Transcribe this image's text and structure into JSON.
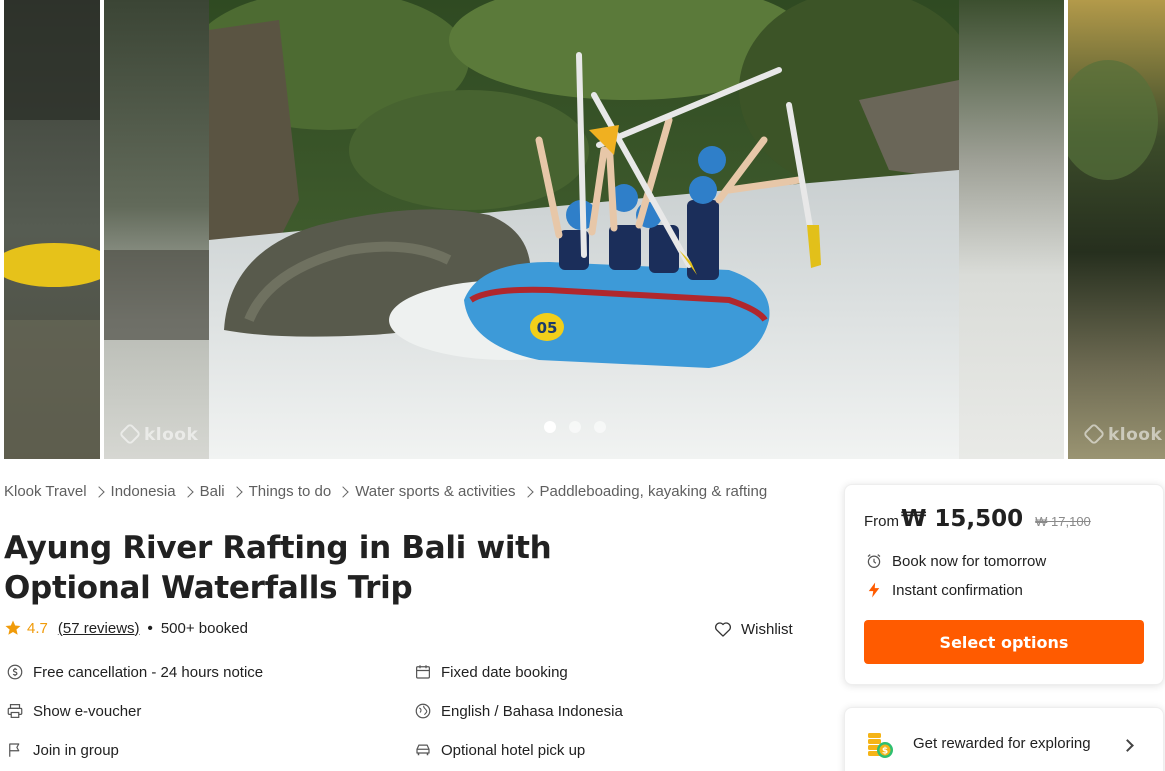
{
  "gallery": {
    "watermark": "klook",
    "slide_count": 3,
    "active_slide": 0,
    "raft_number": "05"
  },
  "breadcrumb": [
    "Klook Travel",
    "Indonesia",
    "Bali",
    "Things to do",
    "Water sports & activities",
    "Paddleboading, kayaking & rafting"
  ],
  "activity": {
    "title": "Ayung River Rafting in Bali with Optional Waterfalls Trip",
    "rating": "4.7",
    "reviews_link": "(57 reviews)",
    "booked": "500+ booked",
    "wishlist_label": "Wishlist"
  },
  "features": {
    "left": [
      {
        "label": "Free cancellation - 24 hours notice",
        "icon": "cancellation-icon"
      },
      {
        "label": "Show e-voucher",
        "icon": "printer-icon"
      },
      {
        "label": "Join in group",
        "icon": "flag-icon"
      }
    ],
    "right": [
      {
        "label": "Fixed date booking",
        "icon": "calendar-icon"
      },
      {
        "label": "English / Bahasa Indonesia",
        "icon": "language-icon"
      },
      {
        "label": "Optional hotel pick up",
        "icon": "car-icon"
      }
    ]
  },
  "booking": {
    "from_label": "From",
    "price": "₩ 15,500",
    "original_price": "₩ 17,100",
    "availability": "Book now for tomorrow",
    "confirmation": "Instant confirmation",
    "select_label": "Select options"
  },
  "rewards": {
    "label": "Get rewarded for exploring"
  },
  "colors": {
    "accent": "#ff5b00",
    "rating": "#f09b0a",
    "text": "#212121",
    "muted": "#8a8a8a"
  }
}
